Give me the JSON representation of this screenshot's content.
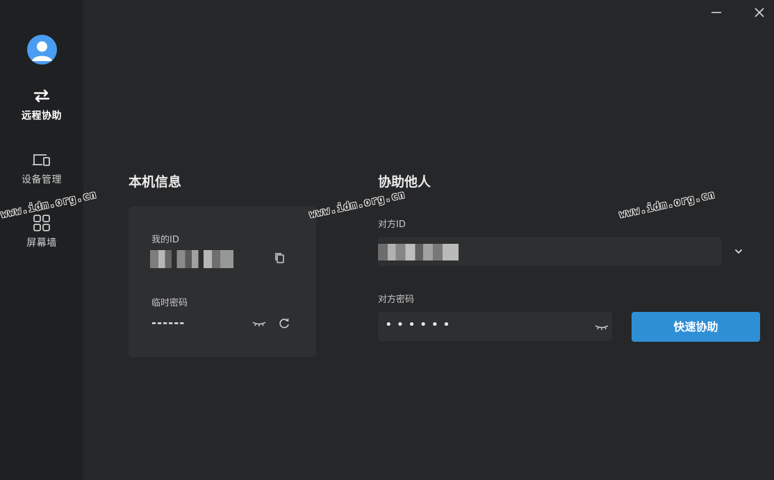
{
  "sidebar": {
    "items": [
      {
        "label": "远程协助",
        "icon": "swap-arrows-icon",
        "active": true
      },
      {
        "label": "设备管理",
        "icon": "devices-icon",
        "active": false
      },
      {
        "label": "屏幕墙",
        "icon": "grid-icon",
        "active": false
      }
    ]
  },
  "local": {
    "title": "本机信息",
    "my_id_label": "我的ID",
    "temp_password_label": "临时密码",
    "temp_password_value": "------"
  },
  "help": {
    "title": "协助他人",
    "peer_id_label": "对方ID",
    "peer_password_label": "对方密码",
    "peer_password_value": "••••••",
    "connect_label": "快速协助"
  },
  "watermark": "www.idm.org.cn",
  "colors": {
    "background": "#262729",
    "sidebar": "#1f2022",
    "card": "#2e2f31",
    "accent": "#2f8fd5",
    "avatar": "#4a9df0"
  }
}
